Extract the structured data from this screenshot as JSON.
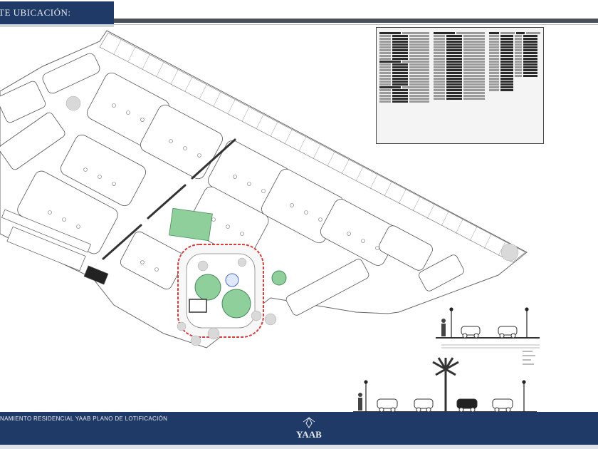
{
  "header": {
    "title": "TE UBICACIÓN:"
  },
  "footer": {
    "title": "NAMIENTO RESIDENCIAL YAAB PLANO DE LOTIFICACIÓN",
    "logo_text": "YAAB"
  },
  "colors": {
    "brand_navy": "#1f3a66",
    "stripe_gray": "#4a4f57",
    "green_space": "#8fcf9c",
    "lot_outline": "#555555",
    "road_red": "#d04040"
  }
}
